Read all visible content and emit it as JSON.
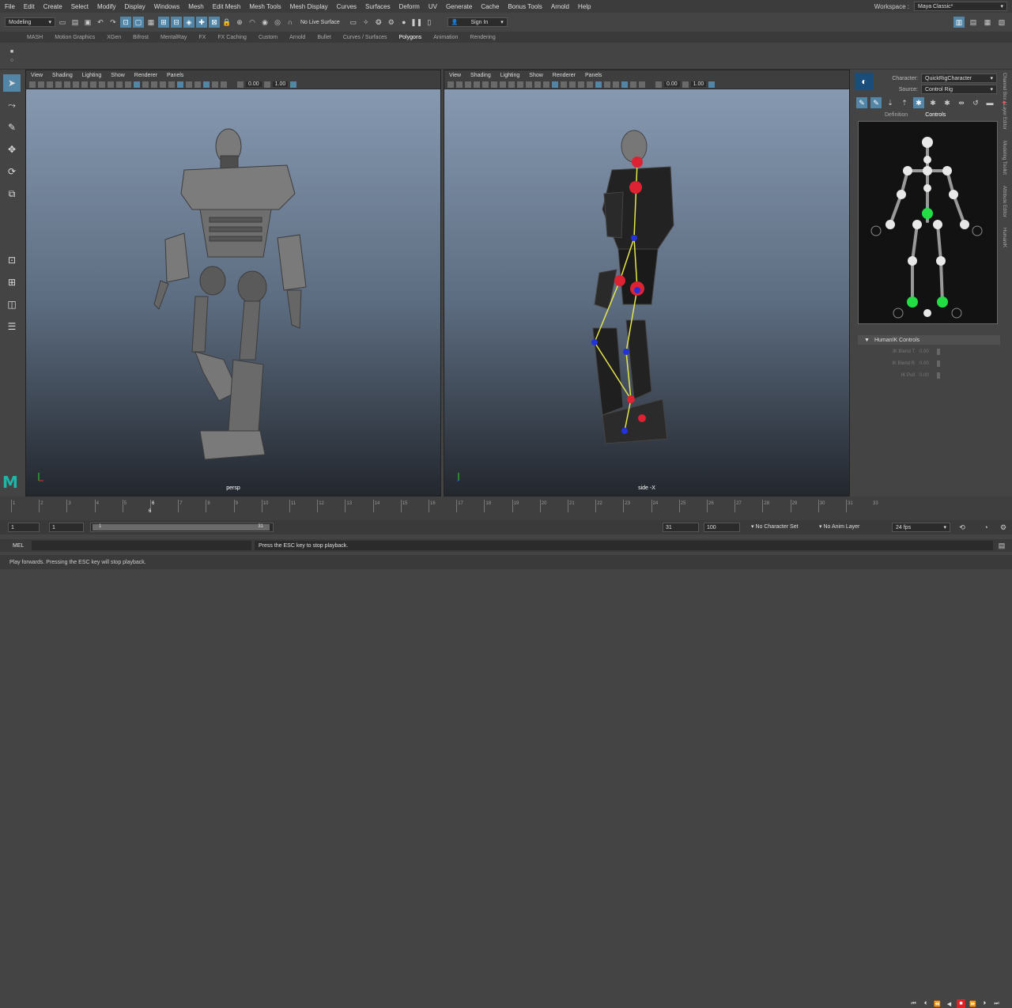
{
  "menubar": {
    "items": [
      "File",
      "Edit",
      "Create",
      "Select",
      "Modify",
      "Display",
      "Windows",
      "Mesh",
      "Edit Mesh",
      "Mesh Tools",
      "Mesh Display",
      "Curves",
      "Surfaces",
      "Deform",
      "UV",
      "Generate",
      "Cache",
      "Bonus Tools",
      "Arnold",
      "Help"
    ],
    "workspace_label": "Workspace :",
    "workspace_value": "Maya Classic*"
  },
  "statusline": {
    "mode": "Modeling",
    "live_surface": "No Live Surface",
    "sign_in": "Sign In"
  },
  "shelf_tabs": {
    "items": [
      "MASH",
      "Motion Graphics",
      "XGen",
      "Bifrost",
      "MentalRay",
      "FX",
      "FX Caching",
      "Custom",
      "Arnold",
      "Bullet",
      "Curves / Surfaces",
      "Polygons",
      "Animation",
      "Rendering"
    ],
    "active": "Polygons"
  },
  "viewport_left": {
    "menus": [
      "View",
      "Shading",
      "Lighting",
      "Show",
      "Renderer",
      "Panels"
    ],
    "field_a": "0.00",
    "field_b": "1.00",
    "camera": "persp"
  },
  "viewport_right": {
    "menus": [
      "View",
      "Shading",
      "Lighting",
      "Show",
      "Renderer",
      "Panels"
    ],
    "field_a": "0.00",
    "field_b": "1.00",
    "camera": "side -X"
  },
  "humanik": {
    "character_label": "Character:",
    "character_value": "QuickRigCharacter",
    "source_label": "Source:",
    "source_value": "Control Rig",
    "tabs": [
      "Definition",
      "Controls"
    ],
    "active_tab": "Controls",
    "section": "HumanIK Controls",
    "sliders": [
      {
        "label": "IK Blend T",
        "value": "0.00"
      },
      {
        "label": "IK Blend R",
        "value": "0.00"
      },
      {
        "label": "IK Pull",
        "value": "0.00"
      }
    ]
  },
  "side_tabs": [
    "Channel Box / Layer Editor",
    "Modeling Toolkit",
    "Attribute Editor",
    "HumanIK"
  ],
  "timeslider": {
    "tick_labels": [
      "1",
      "2",
      "3",
      "4",
      "5",
      "6",
      "7",
      "8",
      "9",
      "10",
      "11",
      "12",
      "13",
      "14",
      "15",
      "16",
      "17",
      "18",
      "19",
      "20",
      "21",
      "22",
      "23",
      "24",
      "25",
      "26",
      "27",
      "28",
      "29",
      "30",
      "31"
    ],
    "current_frame": "6",
    "end_label": "33"
  },
  "rangeslider": {
    "start": "1",
    "anim_start": "1",
    "range_start_handle": "1",
    "range_end_handle": "31",
    "anim_end": "31",
    "end": "100",
    "character_set": "No Character Set",
    "anim_layer": "No Anim Layer",
    "fps": "24 fps"
  },
  "cmdline": {
    "label": "MEL",
    "result": "Press the ESC key to stop playback."
  },
  "helpline": {
    "text": "Play forwards. Pressing the ESC key will stop playback."
  },
  "colors": {
    "accent": "#5285a6",
    "stop_button": "#dd2222",
    "maya_logo": "#1fb5a8",
    "hik_green": "#22dd44",
    "rig_red": "#dd2233",
    "rig_blue": "#2233dd",
    "rig_yellow": "#e6e64a"
  }
}
